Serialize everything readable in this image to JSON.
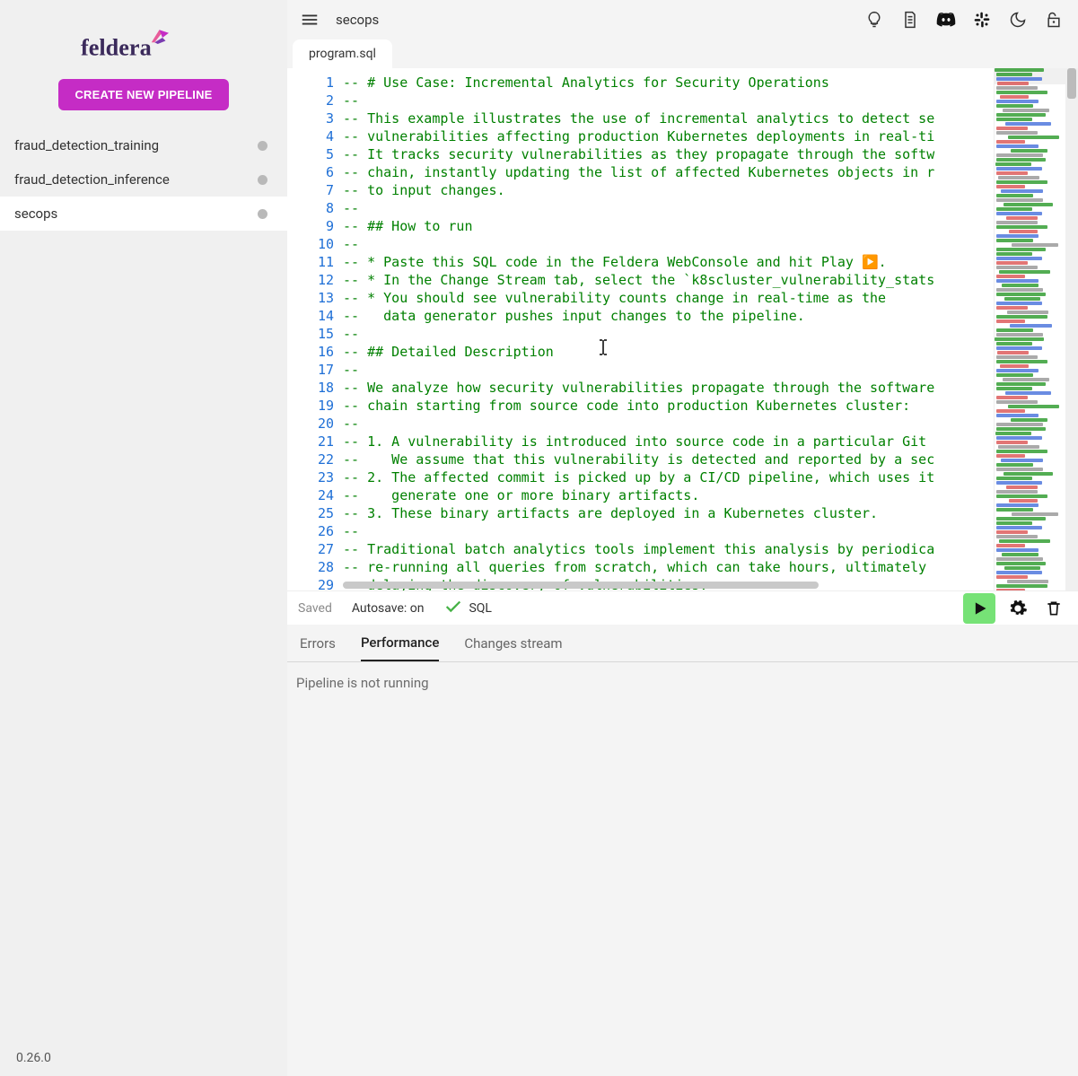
{
  "sidebar": {
    "create_label": "CREATE NEW PIPELINE",
    "pipelines": [
      {
        "name": "fraud_detection_training",
        "active": false
      },
      {
        "name": "fraud_detection_inference",
        "active": false
      },
      {
        "name": "secops",
        "active": true
      }
    ],
    "version": "0.26.0"
  },
  "header": {
    "pipeline_name": "secops",
    "tab_label": "program.sql"
  },
  "editor": {
    "lines": [
      "-- # Use Case: Incremental Analytics for Security Operations",
      "--",
      "-- This example illustrates the use of incremental analytics to detect se",
      "-- vulnerabilities affecting production Kubernetes deployments in real-ti",
      "-- It tracks security vulnerabilities as they propagate through the softw",
      "-- chain, instantly updating the list of affected Kubernetes objects in r",
      "-- to input changes.",
      "--",
      "-- ## How to run",
      "--",
      "-- * Paste this SQL code in the Feldera WebConsole and hit Play ▶️.",
      "-- * In the Change Stream tab, select the `k8scluster_vulnerability_stats",
      "-- * You should see vulnerability counts change in real-time as the",
      "--   data generator pushes input changes to the pipeline.",
      "--",
      "-- ## Detailed Description",
      "--",
      "-- We analyze how security vulnerabilities propagate through the software",
      "-- chain starting from source code into production Kubernetes cluster:",
      "--",
      "-- 1. A vulnerability is introduced into source code in a particular Git ",
      "--    We assume that this vulnerability is detected and reported by a sec",
      "-- 2. The affected commit is picked up by a CI/CD pipeline, which uses it",
      "--    generate one or more binary artifacts.",
      "-- 3. These binary artifacts are deployed in a Kubernetes cluster.",
      "--",
      "-- Traditional batch analytics tools implement this analysis by periodica",
      "-- re-running all queries from scratch, which can take hours, ultimately",
      "-- delaying the discovery of vulnerabilities."
    ]
  },
  "status": {
    "saved": "Saved",
    "autosave": "Autosave: on",
    "sql": "SQL"
  },
  "bottom": {
    "tabs": [
      "Errors",
      "Performance",
      "Changes stream"
    ],
    "active_index": 1,
    "panel_text": "Pipeline is not running"
  }
}
